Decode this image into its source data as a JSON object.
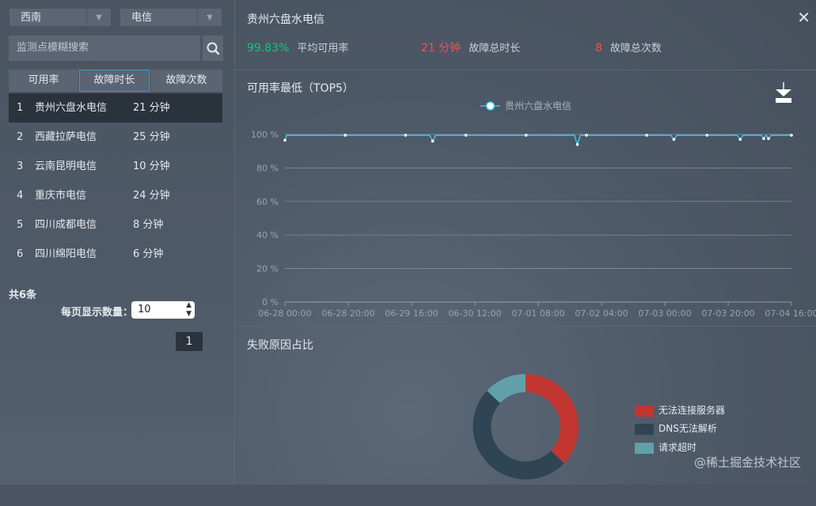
{
  "filters": {
    "region": "西南",
    "carrier": "电信"
  },
  "search": {
    "placeholder": "监测点模糊搜索"
  },
  "tabs": [
    "可用率",
    "故障时长",
    "故障次数"
  ],
  "list": [
    {
      "rank": "1",
      "name": "贵州六盘水电信",
      "value": "21 分钟"
    },
    {
      "rank": "2",
      "name": "西藏拉萨电信",
      "value": "25 分钟"
    },
    {
      "rank": "3",
      "name": "云南昆明电信",
      "value": "10 分钟"
    },
    {
      "rank": "4",
      "name": "重庆市电信",
      "value": "24 分钟"
    },
    {
      "rank": "5",
      "name": "四川成都电信",
      "value": "8 分钟"
    },
    {
      "rank": "6",
      "name": "四川绵阳电信",
      "value": "6 分钟"
    }
  ],
  "pagination": {
    "total": "共6条",
    "per_page_label": "每页显示数量：",
    "per_page": "10",
    "page": "1"
  },
  "detail": {
    "title": "贵州六盘水电信",
    "stats": [
      {
        "value": "99.83%",
        "label": "平均可用率",
        "color": "#19c27b"
      },
      {
        "value": "21 分钟",
        "label": "故障总时长",
        "color": "#ee5252"
      },
      {
        "value": "8",
        "label": "故障总次数",
        "color": "#ee5252"
      }
    ],
    "chart1_title": "可用率最低（TOP5）",
    "chart2_title": "失败原因占比"
  },
  "watermark": "@稀土掘金技术社区",
  "chart_data": [
    {
      "type": "line",
      "series": [
        {
          "name": "贵州六盘水电信",
          "color": "#3bc3f0",
          "points": [
            [
              0,
              96.5
            ],
            [
              0.3,
              99.5
            ],
            [
              10,
              99.5
            ],
            [
              20,
              99.5
            ],
            [
              24,
              99.5
            ],
            [
              24.5,
              96
            ],
            [
              25,
              99.5
            ],
            [
              30,
              99.5
            ],
            [
              40,
              99.5
            ],
            [
              48,
              99.5
            ],
            [
              48.5,
              94
            ],
            [
              49,
              99.5
            ],
            [
              50,
              99.5
            ],
            [
              60,
              99.5
            ],
            [
              64,
              99.5
            ],
            [
              64.5,
              97
            ],
            [
              65,
              99.5
            ],
            [
              70,
              99.5
            ],
            [
              75,
              99.5
            ],
            [
              75.5,
              97
            ],
            [
              76,
              99.5
            ],
            [
              79,
              99.5
            ],
            [
              79.4,
              97.5
            ],
            [
              79.8,
              99.5
            ],
            [
              80.2,
              97.5
            ],
            [
              80.6,
              99.5
            ],
            [
              84,
              99.5
            ]
          ]
        }
      ],
      "x_labels": [
        "06-28 00:00",
        "06-28 20:00",
        "06-29 16:00",
        "06-30 12:00",
        "07-01 08:00",
        "07-02 04:00",
        "07-03 00:00",
        "07-03 20:00",
        "07-04 16:00"
      ],
      "x_range": [
        0,
        84
      ],
      "y_ticks": [
        "0 %",
        "20 %",
        "40 %",
        "60 %",
        "80 %",
        "100 %"
      ],
      "ylim": [
        0,
        100
      ],
      "grid": true,
      "legend": "top-center"
    },
    {
      "type": "pie",
      "donut": true,
      "slices": [
        {
          "label": "无法连接服务器",
          "value": 37,
          "color": "#c23531"
        },
        {
          "label": "DNS无法解析",
          "value": 50,
          "color": "#2f4554"
        },
        {
          "label": "请求超时",
          "value": 13,
          "color": "#61a0a8"
        }
      ],
      "legend": "right"
    }
  ]
}
